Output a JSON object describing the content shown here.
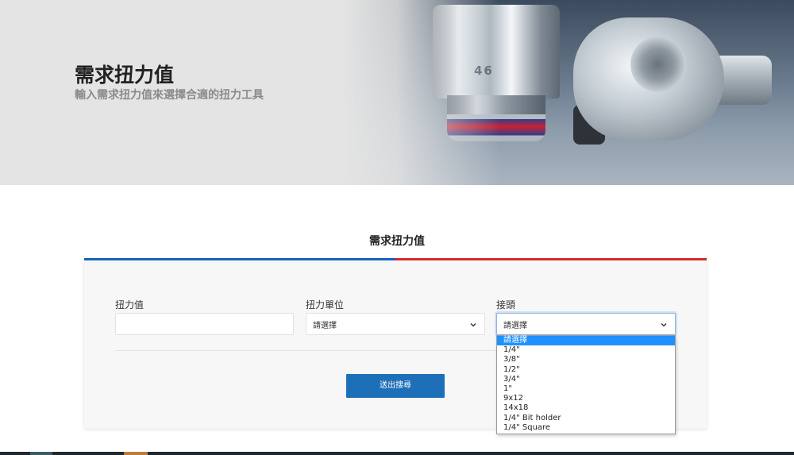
{
  "hero": {
    "title": "需求扭力值",
    "subtitle": "輸入需求扭力值來選擇合適的扭力工具",
    "socket_marking": "46"
  },
  "section": {
    "title": "需求扭力值",
    "accent_left": "#1565c0",
    "accent_right": "#d32f2f"
  },
  "form": {
    "torque_label": "扭力值",
    "torque_value": "",
    "unit_label": "扭力單位",
    "unit_selected": "請選擇",
    "connector_label": "接頭",
    "connector_selected": "請選擇",
    "submit_label": "送出搜尋"
  },
  "connector_options": [
    "請選擇",
    "1/4\"",
    "3/8\"",
    "1/2\"",
    "3/4\"",
    "1\"",
    "9x12",
    "14x18",
    "1/4\" Bit holder",
    "1/4\" Square"
  ],
  "colors": {
    "button": "#1d6fb8",
    "option_highlight": "#1e90ff"
  }
}
